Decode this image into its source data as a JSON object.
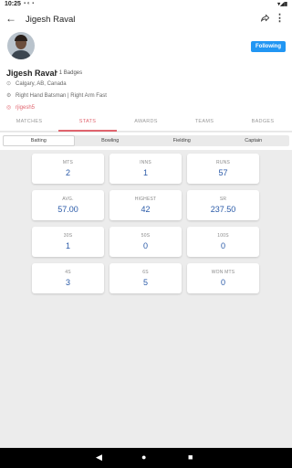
{
  "status_bar": {
    "time": "10:25",
    "left_icons": "▪ ◐ ▪",
    "right_icons": "▾◢▮"
  },
  "app_bar": {
    "title": "Jigesh Raval"
  },
  "profile": {
    "name": "Jigesh Raval",
    "badge_text": "1 Badges",
    "follow_label": "Following",
    "location": "Calgary, AB, Canada",
    "role": "Right Hand Batsman | Right Arm Fast",
    "handle": "rjigesh5"
  },
  "tabs": [
    "MATCHES",
    "STATS",
    "AWARDS",
    "TEAMS",
    "BADGES"
  ],
  "subtabs": [
    "Batting",
    "Bowling",
    "Fielding",
    "Captain"
  ],
  "stats": [
    {
      "label": "MTS",
      "value": "2"
    },
    {
      "label": "INNS",
      "value": "1"
    },
    {
      "label": "RUNS",
      "value": "57"
    },
    {
      "label": "AVG.",
      "value": "57.00"
    },
    {
      "label": "HIGHEST",
      "value": "42"
    },
    {
      "label": "SR",
      "value": "237.50"
    },
    {
      "label": "30S",
      "value": "1"
    },
    {
      "label": "50S",
      "value": "0"
    },
    {
      "label": "100S",
      "value": "0"
    },
    {
      "label": "4S",
      "value": "3"
    },
    {
      "label": "6S",
      "value": "5"
    },
    {
      "label": "WON MTS",
      "value": "0"
    }
  ],
  "colors": {
    "accent": "#e0646e",
    "follow_button": "#2196f3",
    "stat_value": "#2a5aa8"
  }
}
